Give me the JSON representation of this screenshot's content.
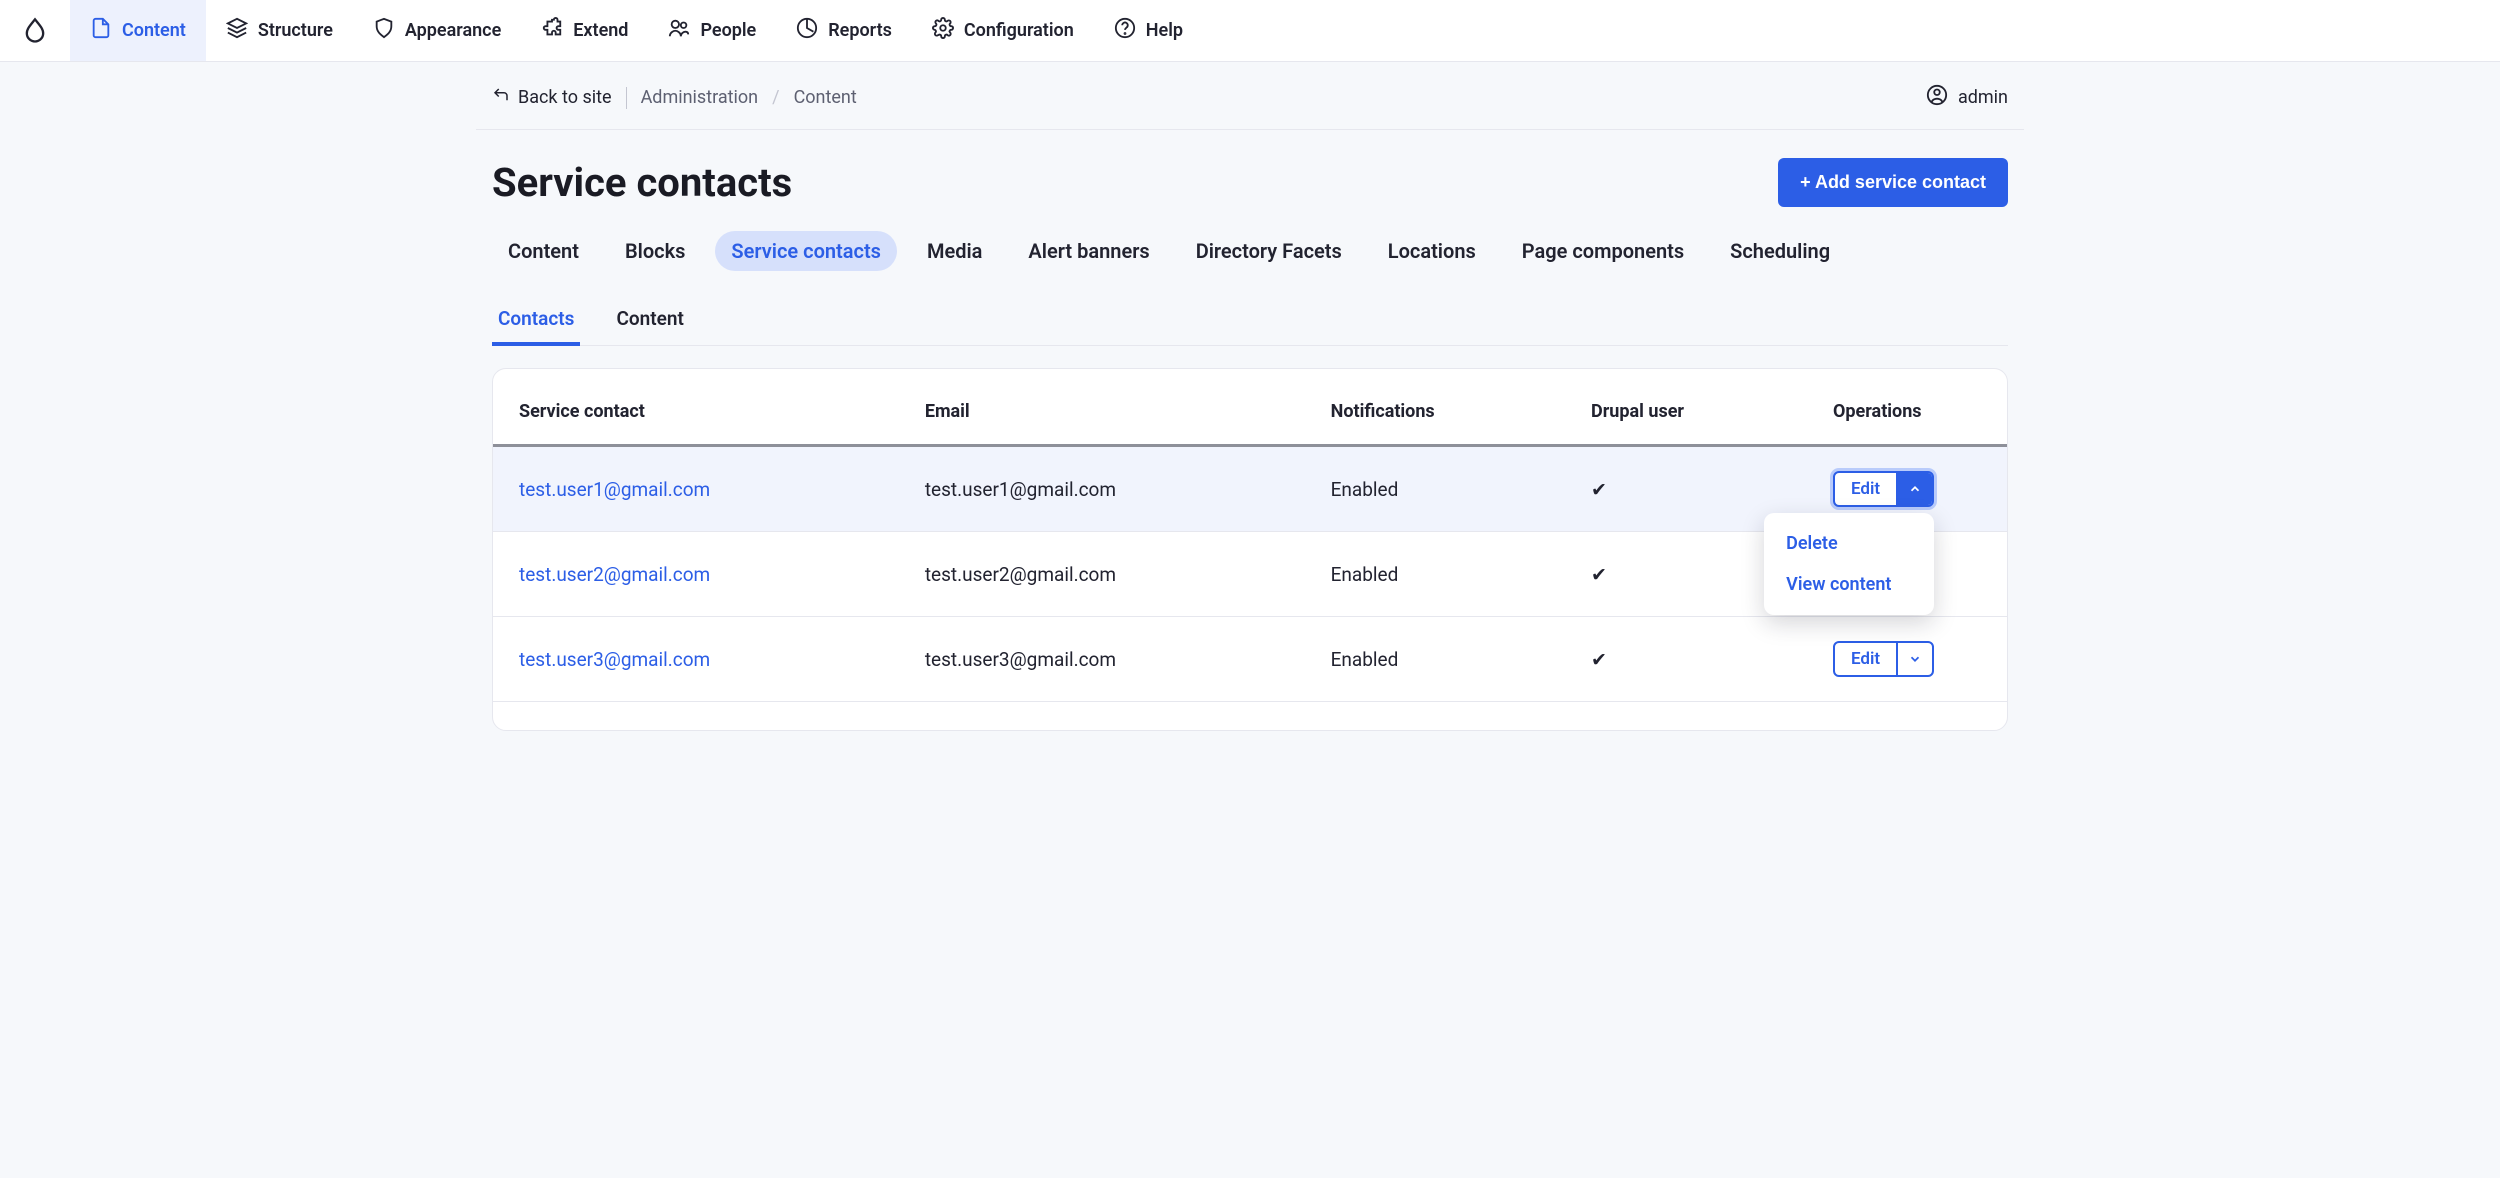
{
  "toolbar": {
    "items": [
      {
        "label": "Content",
        "active": true
      },
      {
        "label": "Structure",
        "active": false
      },
      {
        "label": "Appearance",
        "active": false
      },
      {
        "label": "Extend",
        "active": false
      },
      {
        "label": "People",
        "active": false
      },
      {
        "label": "Reports",
        "active": false
      },
      {
        "label": "Configuration",
        "active": false
      },
      {
        "label": "Help",
        "active": false
      }
    ]
  },
  "breadcrumb": {
    "back_label": "Back to site",
    "items": [
      "Administration",
      "Content"
    ],
    "user": "admin"
  },
  "page": {
    "title": "Service contacts",
    "add_button": "+ Add service contact"
  },
  "tabs": {
    "primary": [
      {
        "label": "Content",
        "active": false
      },
      {
        "label": "Blocks",
        "active": false
      },
      {
        "label": "Service contacts",
        "active": true
      },
      {
        "label": "Media",
        "active": false
      },
      {
        "label": "Alert banners",
        "active": false
      },
      {
        "label": "Directory Facets",
        "active": false
      },
      {
        "label": "Locations",
        "active": false
      },
      {
        "label": "Page components",
        "active": false
      },
      {
        "label": "Scheduling",
        "active": false
      }
    ],
    "secondary": [
      {
        "label": "Contacts",
        "active": true
      },
      {
        "label": "Content",
        "active": false
      }
    ]
  },
  "table": {
    "headers": [
      "Service contact",
      "Email",
      "Notifications",
      "Drupal user",
      "Operations"
    ],
    "op_default": "Edit",
    "op_menu": [
      "Delete",
      "View content"
    ],
    "rows": [
      {
        "name": "test.user1@gmail.com",
        "email": "test.user1@gmail.com",
        "notifications": "Enabled",
        "drupal_user": "✔",
        "open": true,
        "highlight": true
      },
      {
        "name": "test.user2@gmail.com",
        "email": "test.user2@gmail.com",
        "notifications": "Enabled",
        "drupal_user": "✔",
        "open": false,
        "highlight": false
      },
      {
        "name": "test.user3@gmail.com",
        "email": "test.user3@gmail.com",
        "notifications": "Enabled",
        "drupal_user": "✔",
        "open": false,
        "highlight": false
      }
    ]
  }
}
